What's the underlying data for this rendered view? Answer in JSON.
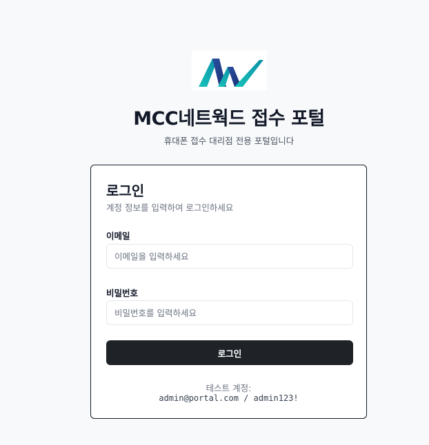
{
  "header": {
    "title": "MCC네트웍드 접수 포털",
    "subtitle": "휴대폰 접수 대리점 전용 포털입니다"
  },
  "login": {
    "title": "로그인",
    "description": "계정 정보를 입력하여 로그인하세요",
    "email_label": "이메일",
    "email_placeholder": "이메일을 입력하세요",
    "email_value": "",
    "password_label": "비밀번호",
    "password_placeholder": "비밀번호를 입력하세요",
    "password_value": "",
    "submit_label": "로그인",
    "test_account_label": "테스트 계정:",
    "test_account_credentials": "admin@portal.com / admin123!"
  },
  "colors": {
    "background": "#f8f9fa",
    "button": "#1f2328",
    "logo_teal": "#13b5b0",
    "logo_navy": "#1e3a8a"
  },
  "icons": {
    "logo": "mcc-logo"
  }
}
